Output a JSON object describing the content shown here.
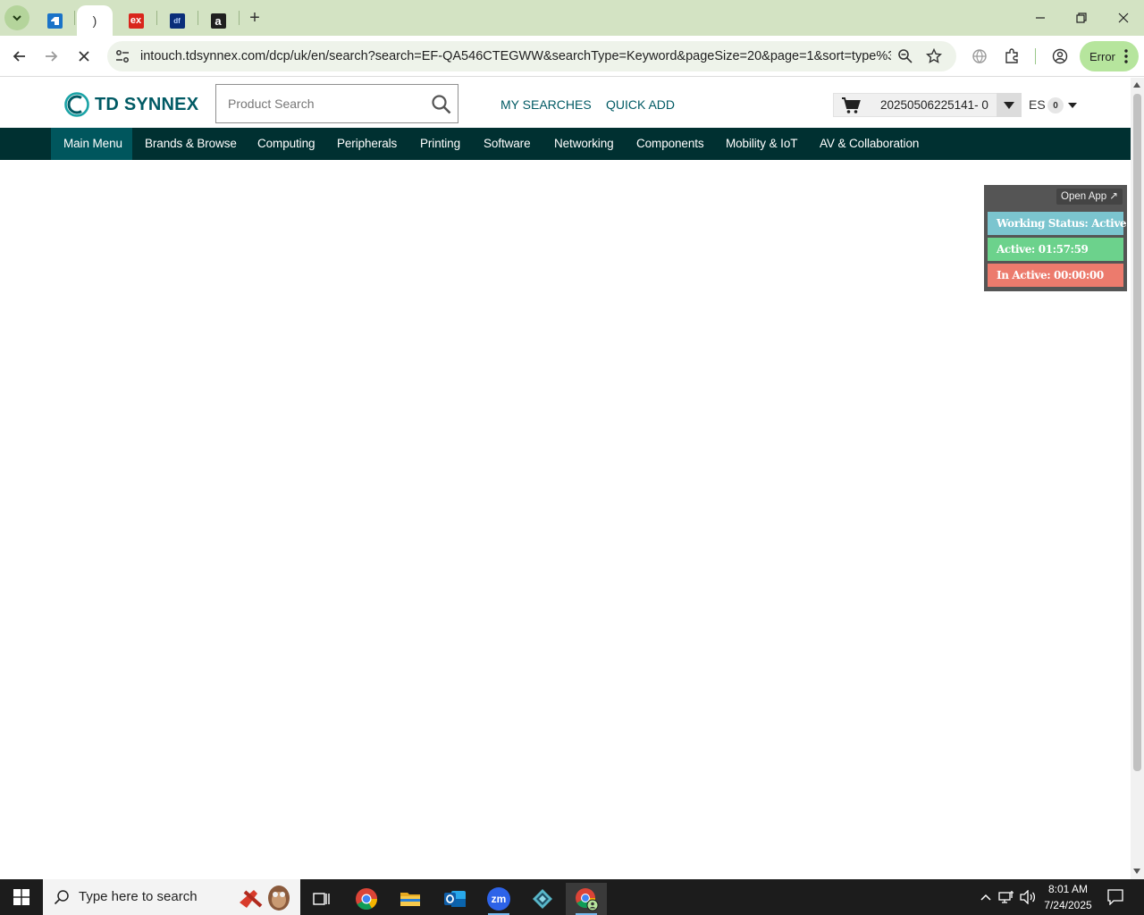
{
  "browser": {
    "address_url": "intouch.tdsynnex.com/dcp/uk/en/search?search=EF-QA546CTEGWW&searchType=Keyword&pageSize=20&page=1&sort=type%3D...",
    "profile_status": "Error",
    "new_tab_symbol": "+",
    "favicons": {
      "tab2": ")",
      "tab3": "ex",
      "tab4": "df",
      "tab5": "a"
    }
  },
  "header": {
    "logo_text": "TD SYNNEX",
    "search_placeholder": "Product Search",
    "my_searches": "MY SEARCHES",
    "quick_add": "QUICK ADD",
    "cart_number": "20250506225141- 0",
    "user_initials": "ES",
    "user_badge_count": "0"
  },
  "nav": {
    "items": [
      {
        "label": "Main Menu"
      },
      {
        "label": "Brands & Browse"
      },
      {
        "label": "Computing"
      },
      {
        "label": "Peripherals"
      },
      {
        "label": "Printing"
      },
      {
        "label": "Software"
      },
      {
        "label": "Networking"
      },
      {
        "label": "Components"
      },
      {
        "label": "Mobility & IoT"
      },
      {
        "label": "AV & Collaboration"
      }
    ]
  },
  "tracker": {
    "open_app": "Open App ↗",
    "working_status": "Working Status: Active",
    "active_time": "Active: 01:57:59",
    "inactive_time": "In Active: 00:00:00",
    "colors": {
      "working": "#7bc5cf",
      "active": "#6cd28c",
      "inactive": "#ec7b6d"
    }
  },
  "taskbar": {
    "search_placeholder": "Type here to search",
    "zoom_label": "zm",
    "time": "8:01 AM",
    "date": "7/24/2025"
  },
  "colors": {
    "brand_teal": "#005a64",
    "nav_bg": "#003031",
    "nav_active": "#00565d",
    "tab_strip": "#d3e3c3"
  }
}
